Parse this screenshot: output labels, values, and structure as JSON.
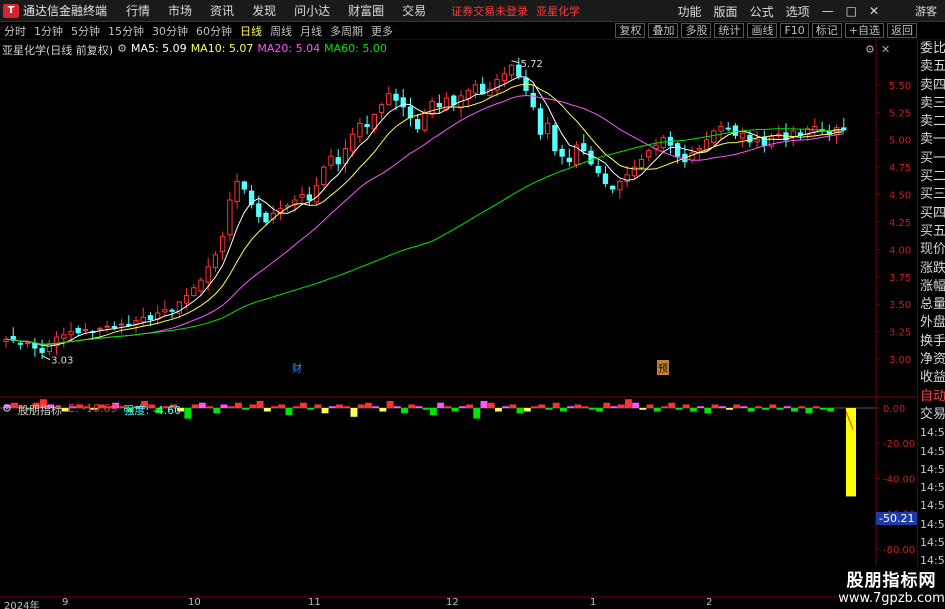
{
  "titlebar": {
    "app_name": "通达信金融终端",
    "menus": [
      "行情",
      "市场",
      "资讯",
      "发现",
      "问小达",
      "财富圈",
      "交易"
    ],
    "notice": "证券交易未登录",
    "stock_name": "亚星化学",
    "right_menus": [
      "功能",
      "版面",
      "公式",
      "选项"
    ],
    "guest": "游客"
  },
  "periodbar": {
    "periods": [
      "分时",
      "1分钟",
      "5分钟",
      "15分钟",
      "30分钟",
      "60分钟",
      "日线",
      "周线",
      "月线",
      "多周期",
      "更多"
    ],
    "active": "日线",
    "tools": [
      "复权",
      "叠加",
      "多股",
      "统计",
      "画线",
      "F10",
      "标记",
      "+自选",
      "返回"
    ]
  },
  "legend": {
    "title": "亚星化学(日线 前复权)",
    "ma5": "MA5: 5.09",
    "ma10": "MA10: 5.07",
    "ma20": "MA20: 5.04",
    "ma60": "MA60: 5.00"
  },
  "indicator_legend": {
    "name": "股朋指标",
    "e_value": "E: -10.69",
    "strength": "强度: -4.60"
  },
  "quote_panel": {
    "items": [
      "委比",
      "卖五",
      "卖四",
      "卖三",
      "卖二",
      "卖一",
      "买一",
      "买二",
      "买三",
      "买四",
      "买五",
      "现价",
      "涨跌",
      "涨幅",
      "总量",
      "外盘",
      "换手",
      "净资",
      "收益",
      "自动",
      "交易"
    ],
    "times": [
      "14:55",
      "14:56",
      "14:56",
      "14:56",
      "14:56",
      "14:56",
      "14:56",
      "14:56",
      "14:56",
      "14:56"
    ]
  },
  "main_axis": {
    "labels": [
      "5.50",
      "5.25",
      "5.00",
      "4.75",
      "4.50",
      "4.25",
      "4.00",
      "3.75",
      "3.50",
      "3.25",
      "3.00"
    ]
  },
  "ind_axis": {
    "labels": [
      "0.00",
      "-20.00",
      "-40.00",
      "-60.00",
      "-80.00"
    ],
    "current_value": "-50.21"
  },
  "annotations": {
    "high": "5.72",
    "low": "3.03",
    "cai": "财",
    "yu": "预"
  },
  "date_axis": {
    "labels": [
      "2024年",
      "9",
      "10",
      "11",
      "12",
      "1",
      "2"
    ]
  },
  "watermark": {
    "line1": "股朋指标网",
    "line2": "www.7gpzb.com"
  },
  "colors": {
    "up": "#ff3232",
    "down": "#54ffff",
    "ma5": "#ffffff",
    "ma10": "#ffff54",
    "ma20": "#ff54ff",
    "ma60": "#00e600",
    "grid": "#7a0000"
  },
  "chart_data": {
    "type": "candlestick",
    "y_range": [
      2.9,
      5.8
    ],
    "closes": [
      3.18,
      3.17,
      3.14,
      3.15,
      3.1,
      3.06,
      3.14,
      3.2,
      3.22,
      3.25,
      3.24,
      3.27,
      3.25,
      3.28,
      3.3,
      3.29,
      3.32,
      3.31,
      3.35,
      3.38,
      3.36,
      3.42,
      3.45,
      3.44,
      3.52,
      3.58,
      3.65,
      3.72,
      3.84,
      3.95,
      4.12,
      4.45,
      4.62,
      4.55,
      4.41,
      4.3,
      4.25,
      4.33,
      4.37,
      4.4,
      4.45,
      4.5,
      4.45,
      4.58,
      4.75,
      4.85,
      4.78,
      4.92,
      5.05,
      5.15,
      5.12,
      5.23,
      5.32,
      5.42,
      5.36,
      5.3,
      5.2,
      5.1,
      5.25,
      5.35,
      5.3,
      5.38,
      5.32,
      5.4,
      5.45,
      5.5,
      5.42,
      5.46,
      5.55,
      5.6,
      5.68,
      5.58,
      5.45,
      5.3,
      5.05,
      5.15,
      4.9,
      4.85,
      4.8,
      4.95,
      4.9,
      4.78,
      4.7,
      4.6,
      4.55,
      4.62,
      4.68,
      4.75,
      4.82,
      4.9,
      4.95,
      5.02,
      4.95,
      4.85,
      4.8,
      4.88,
      4.92,
      5.0,
      5.08,
      5.12,
      5.1,
      5.04,
      5.06,
      4.98,
      5.0,
      4.95,
      5.03,
      5.05,
      5.0,
      5.08,
      5.04,
      5.1,
      5.12,
      5.08,
      5.05,
      5.11,
      5.09
    ],
    "indicator_values": [
      2,
      3,
      1,
      -1,
      3,
      5,
      2,
      1,
      -2,
      1,
      2,
      1,
      -1,
      2,
      1,
      3,
      1,
      -2,
      1,
      4,
      2,
      -3,
      1,
      2,
      -2,
      -6,
      2,
      3,
      1,
      -3,
      2,
      1,
      3,
      -1,
      2,
      4,
      -2,
      1,
      2,
      -4,
      1,
      3,
      -1,
      2,
      -3,
      1,
      2,
      1,
      -5,
      2,
      3,
      1,
      -2,
      4,
      1,
      -3,
      2,
      1,
      -1,
      -4,
      3,
      1,
      -2,
      1,
      2,
      -6,
      4,
      3,
      -2,
      1,
      2,
      -3,
      -2,
      1,
      2,
      -1,
      3,
      -2,
      1,
      2,
      1,
      -1,
      -2,
      3,
      1,
      2,
      5,
      3,
      -1,
      2,
      -2,
      1,
      3,
      -1,
      2,
      -2,
      1,
      -3,
      2,
      1,
      -1,
      2,
      1,
      -2,
      1,
      -1,
      2,
      -1,
      1,
      -2,
      1,
      -3,
      1,
      -1,
      -2,
      -50.21
    ]
  }
}
